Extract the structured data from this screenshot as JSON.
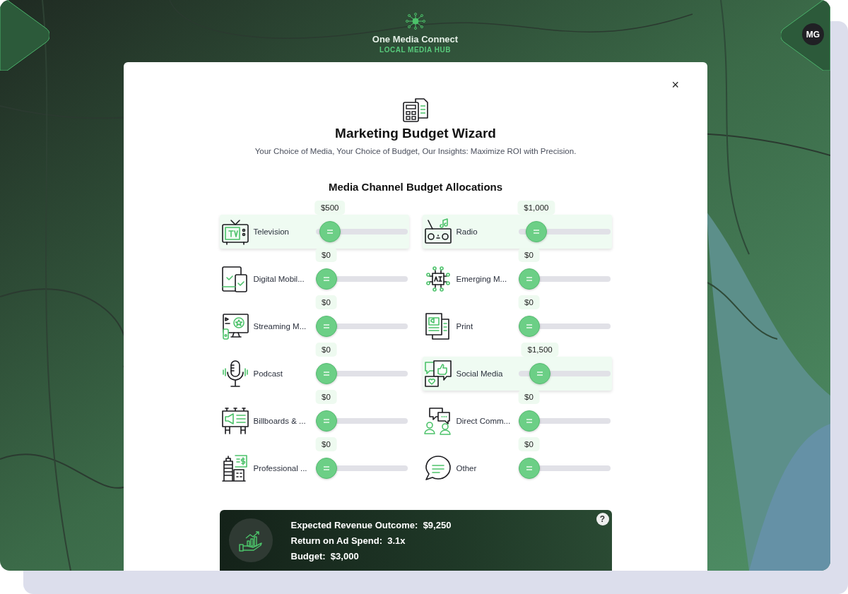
{
  "header": {
    "title": "One Media Connect",
    "subtitle": "LOCAL MEDIA HUB"
  },
  "user": {
    "initials": "MG"
  },
  "dialog": {
    "close": "×",
    "title": "Marketing Budget Wizard",
    "tagline": "Your Choice of Media, Your Choice of Budget, Our Insights: Maximize ROI with Precision.",
    "section_title": "Media Channel Budget Allocations",
    "channels": [
      {
        "name": "Television",
        "amount": "$500",
        "level": 0.05,
        "highlighted": true
      },
      {
        "name": "Radio",
        "amount": "$1,000",
        "level": 0.1,
        "highlighted": true
      },
      {
        "name": "Digital Mobil...",
        "amount": "$0",
        "level": 0,
        "highlighted": false
      },
      {
        "name": "Emerging M...",
        "amount": "$0",
        "level": 0,
        "highlighted": false
      },
      {
        "name": "Streaming M...",
        "amount": "$0",
        "level": 0,
        "highlighted": false
      },
      {
        "name": "Print",
        "amount": "$0",
        "level": 0,
        "highlighted": false
      },
      {
        "name": "Podcast",
        "amount": "$0",
        "level": 0,
        "highlighted": false
      },
      {
        "name": "Social Media",
        "amount": "$1,500",
        "level": 0.15,
        "highlighted": true
      },
      {
        "name": "Billboards & ...",
        "amount": "$0",
        "level": 0,
        "highlighted": false
      },
      {
        "name": "Direct Comm...",
        "amount": "$0",
        "level": 0,
        "highlighted": false
      },
      {
        "name": "Professional ...",
        "amount": "$0",
        "level": 0,
        "highlighted": false
      },
      {
        "name": "Other",
        "amount": "$0",
        "level": 0,
        "highlighted": false
      }
    ],
    "summary": {
      "help": "?",
      "lines": [
        {
          "label": "Expected Revenue Outcome:",
          "value": "$9,250"
        },
        {
          "label": "Return on Ad Spend:",
          "value": "3.1x"
        },
        {
          "label": "Budget:",
          "value": "$3,000"
        }
      ]
    }
  }
}
